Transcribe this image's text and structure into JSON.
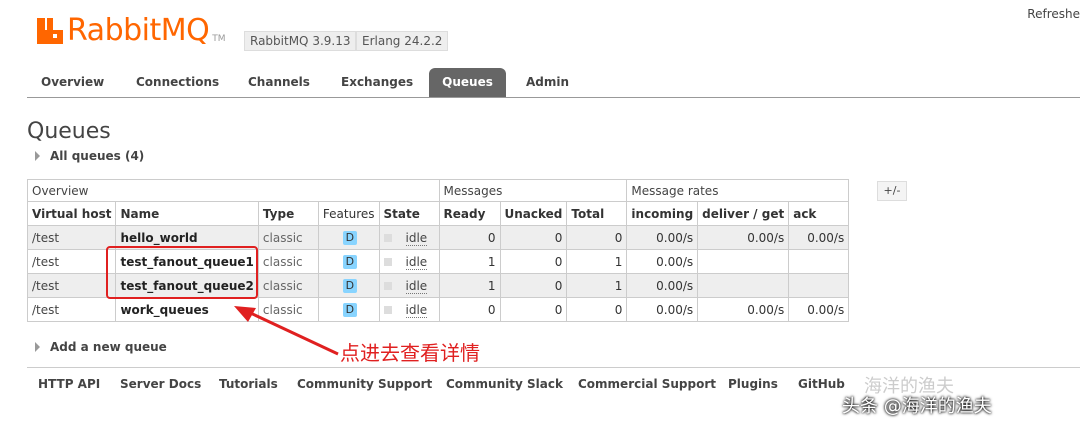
{
  "header": {
    "logo_text": "RabbitMQ",
    "logo_tm": "TM",
    "rabbit_version": "RabbitMQ 3.9.13",
    "erlang_version": "Erlang 24.2.2",
    "refresh_label": "Refreshe"
  },
  "tabs": [
    {
      "label": "Overview"
    },
    {
      "label": "Connections"
    },
    {
      "label": "Channels"
    },
    {
      "label": "Exchanges"
    },
    {
      "label": "Queues",
      "active": true
    },
    {
      "label": "Admin"
    }
  ],
  "page": {
    "title": "Queues",
    "all_queues_label": "All queues (4)",
    "add_queue_label": "Add a new queue",
    "plus_minus": "+/-"
  },
  "table": {
    "groups": {
      "overview": "Overview",
      "messages": "Messages",
      "rates": "Message rates"
    },
    "columns": [
      "Virtual host",
      "Name",
      "Type",
      "Features",
      "State",
      "Ready",
      "Unacked",
      "Total",
      "incoming",
      "deliver / get",
      "ack"
    ],
    "rows": [
      {
        "vhost": "/test",
        "name": "hello_world",
        "type": "classic",
        "feature": "D",
        "state": "idle",
        "ready": "0",
        "unacked": "0",
        "total": "0",
        "incoming": "0.00/s",
        "deliver": "0.00/s",
        "ack": "0.00/s"
      },
      {
        "vhost": "/test",
        "name": "test_fanout_queue1",
        "type": "classic",
        "feature": "D",
        "state": "idle",
        "ready": "1",
        "unacked": "0",
        "total": "1",
        "incoming": "0.00/s",
        "deliver": "",
        "ack": ""
      },
      {
        "vhost": "/test",
        "name": "test_fanout_queue2",
        "type": "classic",
        "feature": "D",
        "state": "idle",
        "ready": "1",
        "unacked": "0",
        "total": "1",
        "incoming": "0.00/s",
        "deliver": "",
        "ack": ""
      },
      {
        "vhost": "/test",
        "name": "work_queues",
        "type": "classic",
        "feature": "D",
        "state": "idle",
        "ready": "0",
        "unacked": "0",
        "total": "0",
        "incoming": "0.00/s",
        "deliver": "0.00/s",
        "ack": "0.00/s"
      }
    ]
  },
  "annotation": {
    "text": "点进去查看详情",
    "color": "#e02020"
  },
  "footer": {
    "links": [
      "HTTP API",
      "Server Docs",
      "Tutorials",
      "Community Support",
      "Community Slack",
      "Commercial Support",
      "Plugins",
      "GitHub"
    ]
  },
  "watermark": {
    "line1": "海洋的渔夫",
    "line2": "头条 @海洋的渔夫"
  },
  "colors": {
    "brand": "#ff6600",
    "active_tab": "#666666",
    "annotation": "#e02020",
    "feature_badge": "#88d4ff"
  }
}
